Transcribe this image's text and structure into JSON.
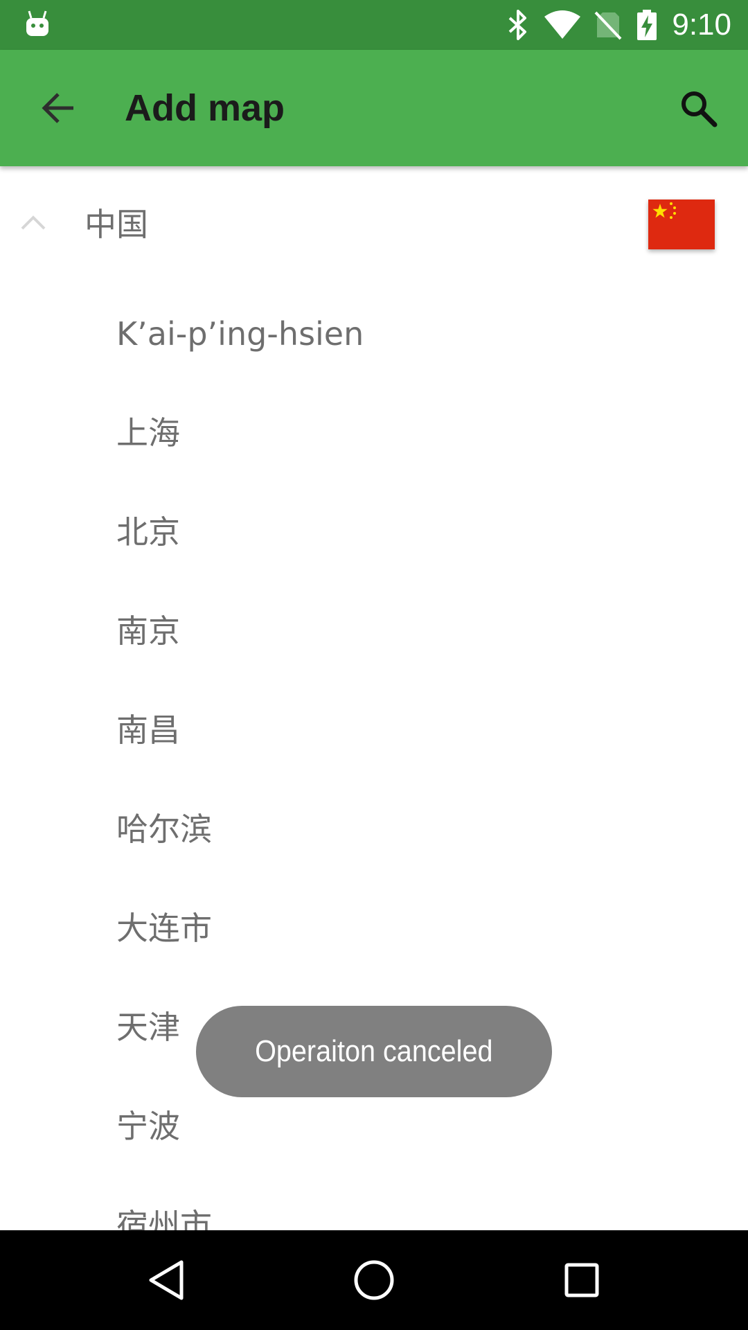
{
  "status_bar": {
    "time": "9:10",
    "icons": [
      "android-icon",
      "bluetooth-icon",
      "wifi-icon",
      "no-sim-icon",
      "battery-charging-icon"
    ],
    "background": "#388e3c"
  },
  "app_bar": {
    "title": "Add map",
    "back_icon": "arrow-back-icon",
    "search_icon": "search-icon",
    "background": "#4caf50"
  },
  "list": {
    "group": {
      "label": "中国",
      "expanded": true,
      "flag_icon": "china-flag-icon"
    },
    "items": [
      {
        "label": "K’ai-p’ing-hsien"
      },
      {
        "label": "上海"
      },
      {
        "label": "北京"
      },
      {
        "label": "南京"
      },
      {
        "label": "南昌"
      },
      {
        "label": "哈尔滨"
      },
      {
        "label": "大连市"
      },
      {
        "label": "天津"
      },
      {
        "label": "宁波"
      },
      {
        "label": "宿州市"
      }
    ]
  },
  "toast": {
    "message": "Operaiton canceled"
  },
  "nav_bar": {
    "buttons": [
      "back-triangle-icon",
      "home-circle-icon",
      "recents-square-icon"
    ]
  }
}
